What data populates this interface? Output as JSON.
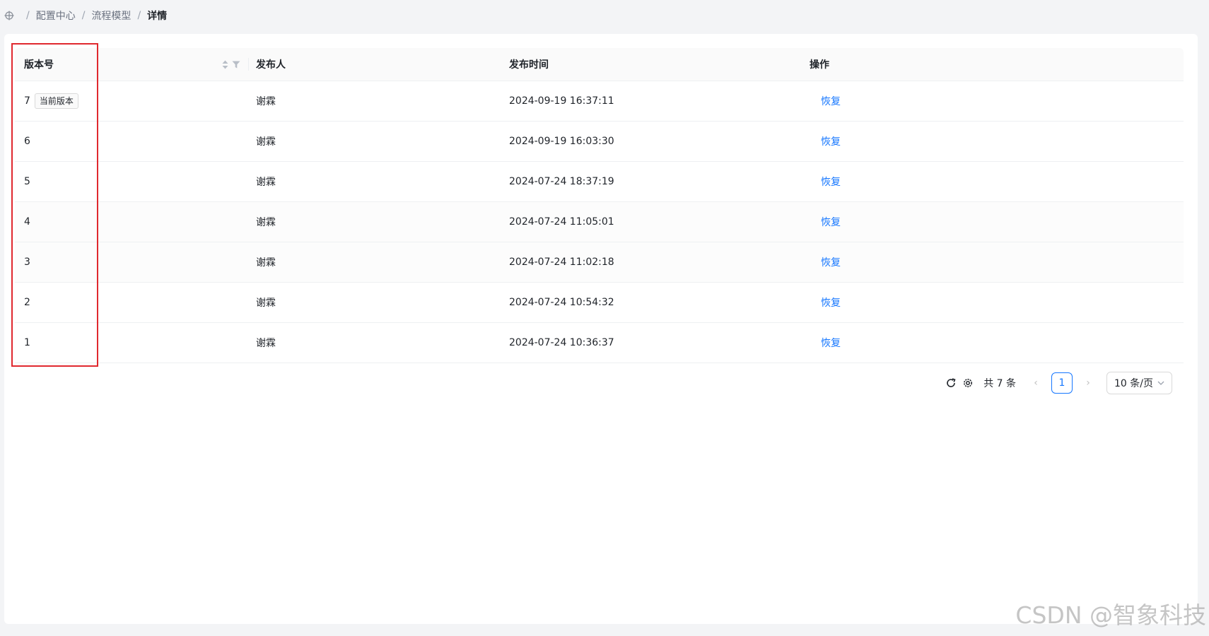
{
  "breadcrumb": {
    "items": [
      "配置中心",
      "流程模型"
    ],
    "current": "详情",
    "separator": "/"
  },
  "table": {
    "headers": {
      "version": "版本号",
      "publisher": "发布人",
      "time": "发布时间",
      "action": "操作"
    },
    "rows": [
      {
        "version": "7",
        "tag": "当前版本",
        "publisher": "谢霖",
        "time": "2024-09-19 16:37:11",
        "action": "恢复"
      },
      {
        "version": "6",
        "tag": "",
        "publisher": "谢霖",
        "time": "2024-09-19 16:03:30",
        "action": "恢复"
      },
      {
        "version": "5",
        "tag": "",
        "publisher": "谢霖",
        "time": "2024-07-24 18:37:19",
        "action": "恢复"
      },
      {
        "version": "4",
        "tag": "",
        "publisher": "谢霖",
        "time": "2024-07-24 11:05:01",
        "action": "恢复"
      },
      {
        "version": "3",
        "tag": "",
        "publisher": "谢霖",
        "time": "2024-07-24 11:02:18",
        "action": "恢复"
      },
      {
        "version": "2",
        "tag": "",
        "publisher": "谢霖",
        "time": "2024-07-24 10:54:32",
        "action": "恢复"
      },
      {
        "version": "1",
        "tag": "",
        "publisher": "谢霖",
        "time": "2024-07-24 10:36:37",
        "action": "恢复"
      }
    ]
  },
  "pagination": {
    "total_text": "共 7 条",
    "current_page": "1",
    "page_size": "10 条/页",
    "prev_symbol": "‹",
    "next_symbol": "›"
  },
  "icons": {
    "home": "crosshair-icon",
    "refresh": "refresh-icon",
    "settings": "gear-icon",
    "sort": "sort-icon",
    "filter": "filter-icon"
  },
  "colors": {
    "accent": "#1677ff",
    "highlight_border": "#e0282e"
  },
  "watermark": "CSDN @智象科技"
}
